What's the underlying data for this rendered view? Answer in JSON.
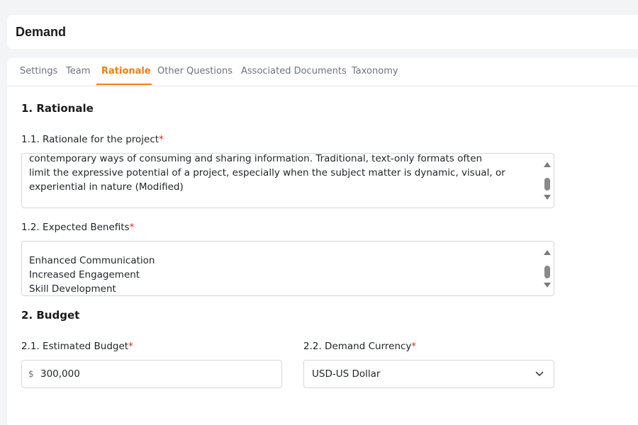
{
  "header": {
    "title": "Demand"
  },
  "tabs": [
    {
      "label": "Settings"
    },
    {
      "label": "Team"
    },
    {
      "label": "Rationale",
      "active": true
    },
    {
      "label": "Other Questions"
    },
    {
      "label": "Associated Documents"
    },
    {
      "label": "Taxonomy"
    }
  ],
  "rationale": {
    "section_title": "1. Rationale",
    "project_label": "1.1. Rationale for the project",
    "project_text": "contemporary ways of consuming and sharing information. Traditional, text-only formats often\nlimit the expressive potential of a project, especially when the subject matter is dynamic, visual, or\nexperiential in nature (Modified)",
    "benefits_label": "1.2. Expected Benefits",
    "benefits_text": "Enhanced Communication\nIncreased Engagement\nSkill Development"
  },
  "budget": {
    "section_title": "2. Budget",
    "estimated_label": "2.1. Estimated Budget",
    "currency_symbol": "$",
    "estimated_value": "300,000",
    "currency_label": "2.2. Demand Currency",
    "currency_value": "USD-US Dollar"
  },
  "required_marker": "*",
  "colors": {
    "accent": "#f07d14",
    "required": "#e02424"
  }
}
